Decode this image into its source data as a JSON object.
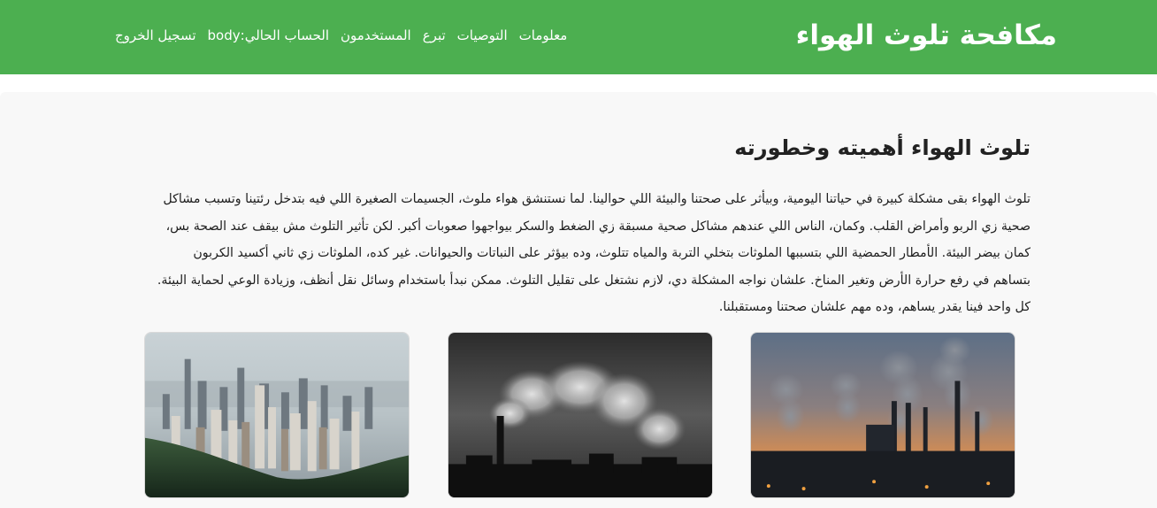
{
  "header": {
    "brand": "مكافحة تلوث الهواء",
    "nav": [
      {
        "id": "info",
        "label": "معلومات"
      },
      {
        "id": "recommendations",
        "label": "التوصيات"
      },
      {
        "id": "donate",
        "label": "تبرع"
      },
      {
        "id": "users",
        "label": "المستخدمون"
      },
      {
        "id": "current-account",
        "label": "الحساب الحالي:body"
      },
      {
        "id": "logout",
        "label": "تسجيل الخروج"
      }
    ]
  },
  "article": {
    "title": "تلوث الهواء أهميته وخطورته",
    "body": "تلوث الهواء بقى مشكلة كبيرة في حياتنا اليومية، وبيأثر على صحتنا والبيئة اللي حوالينا. لما نستنشق هواء ملوث، الجسيمات الصغيرة اللي فيه بتدخل رئتينا وتسبب مشاكل صحية زي الربو وأمراض القلب. وكمان، الناس اللي عندهم مشاكل صحية مسبقة زي الضغط والسكر بيواجهوا صعوبات أكبر. لكن تأثير التلوث مش بيقف عند الصحة بس، كمان بيضر البيئة. الأمطار الحمضية اللي بتسببها الملوثات بتخلي التربة والمياه تتلوث، وده بيؤثر على النباتات والحيوانات. غير كده، الملوثات زي ثاني أكسيد الكربون بتساهم في رفع حرارة الأرض وتغير المناخ. علشان نواجه المشكلة دي، لازم نشتغل على تقليل التلوث. ممكن نبدأ باستخدام وسائل نقل أنظف، وزيادة الوعي لحماية البيئة. كل واحد فينا يقدر يساهم، وده مهم علشان صحتنا ومستقبلنا."
  },
  "images": [
    {
      "id": "factory-smokestacks",
      "icon": "factory-sunset-image"
    },
    {
      "id": "smoke-plume",
      "icon": "smoke-plume-image"
    },
    {
      "id": "smoggy-city",
      "icon": "smoggy-city-image"
    }
  ],
  "colors": {
    "header_bg": "#4caf50",
    "header_text": "#ffffff",
    "content_bg": "#f8f8f8",
    "text": "#1e1e1e"
  }
}
